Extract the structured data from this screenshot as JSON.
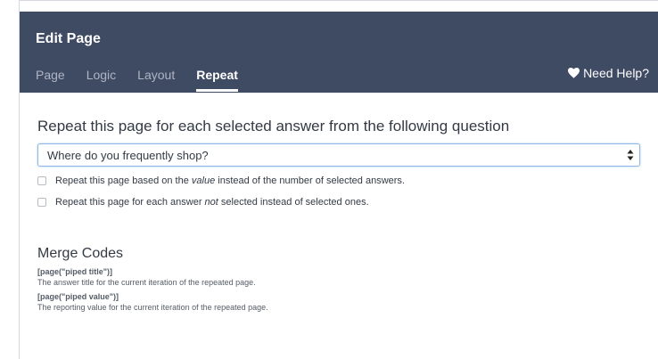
{
  "header": {
    "title": "Edit Page",
    "tabs": [
      {
        "label": "Page",
        "active": false
      },
      {
        "label": "Logic",
        "active": false
      },
      {
        "label": "Layout",
        "active": false
      },
      {
        "label": "Repeat",
        "active": true
      }
    ],
    "help_label": "Need Help?",
    "help_icon": "heart-icon"
  },
  "repeat": {
    "title": "Repeat this page for each selected answer from the following question",
    "selected_question": "Where do you frequently shop?",
    "options": [
      {
        "before": "Repeat this page based on the ",
        "emphasis": "value",
        "after": " instead of the number of selected answers.",
        "checked": false
      },
      {
        "before": "Repeat this page for each answer ",
        "emphasis": "not",
        "after": " selected instead of selected ones.",
        "checked": false
      }
    ]
  },
  "merge_codes": {
    "title": "Merge Codes",
    "items": [
      {
        "code": "[page(\"piped title\")]",
        "description": "The answer title for the current iteration of the repeated page."
      },
      {
        "code": "[page(\"piped value\")]",
        "description": "The reporting value for the current iteration of the repeated page."
      }
    ]
  },
  "colors": {
    "header_bg": "#3f4a63",
    "focus_border": "#8fb8e6"
  }
}
